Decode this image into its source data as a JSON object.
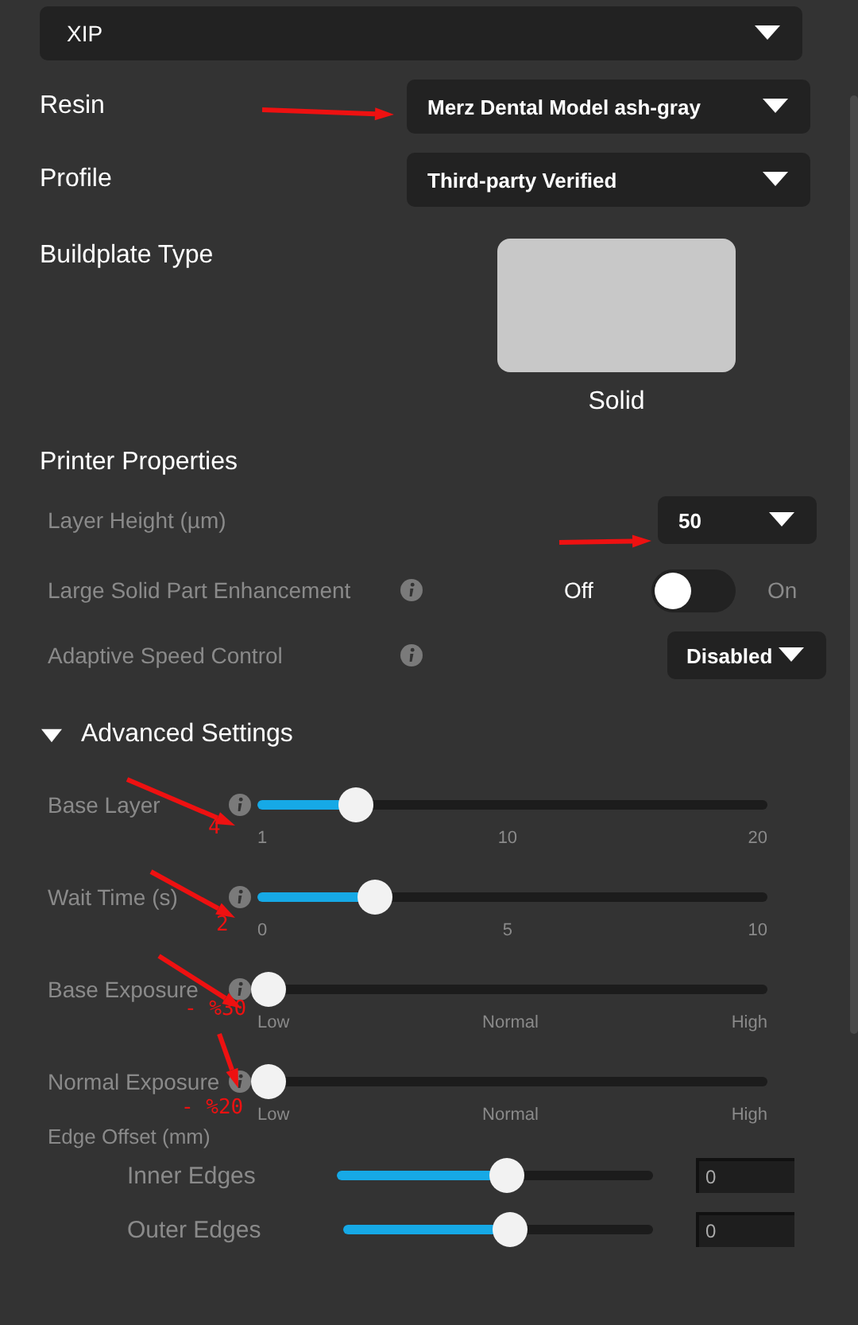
{
  "printer_select": {
    "value": "XIP"
  },
  "fields": [
    {
      "label": "Resin",
      "value": "Merz Dental Model ash-gray"
    },
    {
      "label": "Profile",
      "value": "Third-party Verified"
    }
  ],
  "buildplate": {
    "label": "Buildplate Type",
    "option": "Solid"
  },
  "printer_properties": {
    "title": "Printer Properties",
    "layer_height": {
      "label": "Layer Height (µm)",
      "value": "50"
    },
    "large_solid": {
      "label": "Large Solid Part Enhancement",
      "off_label": "Off",
      "on_label": "On",
      "on": false
    },
    "adaptive_speed": {
      "label": "Adaptive Speed Control",
      "value": "Disabled"
    }
  },
  "advanced": {
    "title": "Advanced Settings",
    "expanded": true,
    "sliders": [
      {
        "label": "Base Layer",
        "level": 0.17,
        "ticks": [
          "1",
          "10",
          "20"
        ],
        "note": "4"
      },
      {
        "label": "Wait Time (s)",
        "level": 0.21,
        "ticks": [
          "0",
          "5",
          "10"
        ],
        "note": "2"
      },
      {
        "label": "Base Exposure",
        "level": 0,
        "ticks": [
          "Low",
          "Normal",
          "High"
        ],
        "note": "- %30"
      },
      {
        "label": "Normal Exposure",
        "level": 0,
        "ticks": [
          "Low",
          "Normal",
          "High"
        ],
        "note": "- %20"
      }
    ],
    "edge_offset": {
      "title": "Edge Offset (mm)",
      "rows": [
        {
          "label": "Inner Edges",
          "level": 0.5,
          "value": "0"
        },
        {
          "label": "Outer Edges",
          "level": 0.5,
          "value": "0"
        }
      ]
    }
  }
}
